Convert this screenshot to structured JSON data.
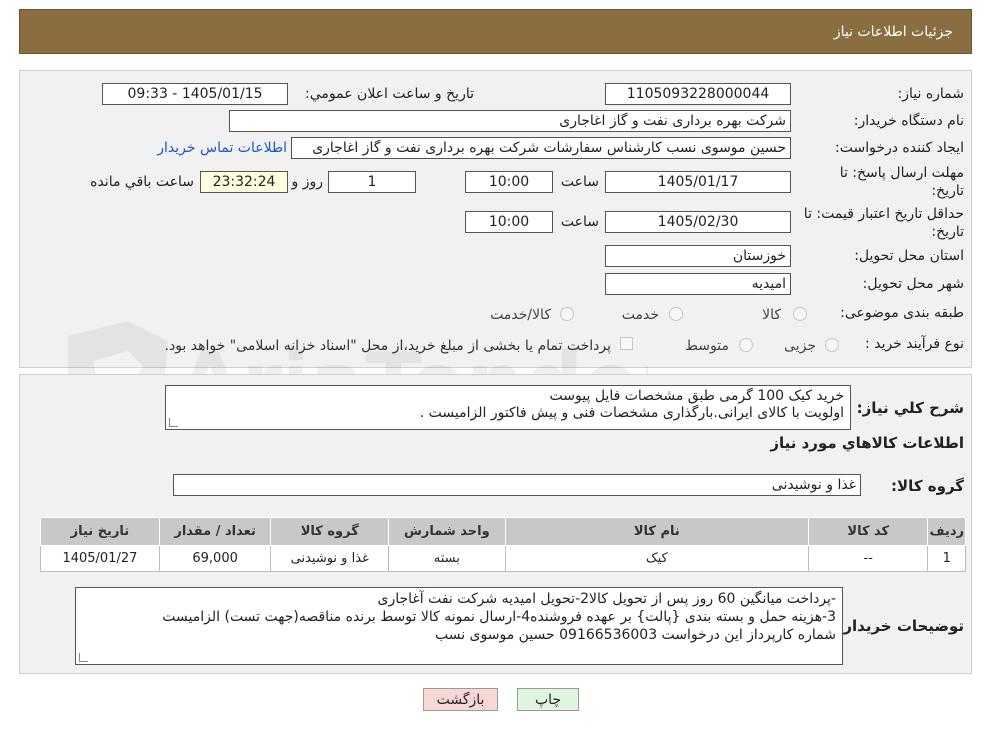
{
  "header": {
    "title": "جزئیات اطلاعات نیاز"
  },
  "form": {
    "need_number_label": "شماره نیاز:",
    "need_number": "1105093228000044",
    "announce_label": "تاریخ و ساعت اعلان عمومي:",
    "announce_value": "1405/01/15 - 09:33",
    "buyer_org_label": "نام دستگاه خریدار:",
    "buyer_org": "شرکت بهره برداری نفت و گاز اغاجاری",
    "creator_label": "ایجاد کننده درخواست:",
    "creator": "حسین موسوی نسب کارشناس سفارشات شرکت بهره برداری نفت و گاز اغاجاری",
    "contact_link": "اطلاعات تماس خریدار",
    "deadline_label_1": "مهلت ارسال پاسخ: تا",
    "deadline_label_2": "تاریخ:",
    "deadline_date": "1405/01/17",
    "time_label": "ساعت",
    "deadline_time": "10:00",
    "days_value": "1",
    "days_label": "روز و",
    "remaining_time": "23:32:24",
    "remaining_label": "ساعت باقي مانده",
    "validity_label_1": "حداقل تاریخ اعتبار قیمت: تا",
    "validity_label_2": "تاریخ:",
    "validity_date": "1405/02/30",
    "validity_time_label": "ساعت",
    "validity_time": "10:00",
    "province_label": "استان محل تحویل:",
    "province": "خوزستان",
    "city_label": "شهر محل تحویل:",
    "city": "امیدیه",
    "category_label": "طبقه بندی موضوعی:",
    "category_options": [
      "کالا",
      "خدمت",
      "کالا/خدمت"
    ],
    "process_label": "نوع فرآیند خرید :",
    "process_options": [
      "جزیی",
      "متوسط"
    ],
    "payment_note": "پرداخت تمام یا بخشی از مبلغ خرید،از محل \"اسناد خزانه اسلامی\" خواهد بود."
  },
  "description": {
    "label": "شرح کلي نياز:",
    "lines": [
      "خرید کیک 100 گرمی  طبق  مشخصات فایل پیوست",
      "اولویت با کالای ایرانی.بارگذاری مشخصات فنی و پیش فاکتور الزامیست ."
    ]
  },
  "goods": {
    "section_title": "اطلاعات کالاهاي مورد نياز",
    "group_label": "گروه کالا:",
    "group_value": "غذا و نوشیدنی",
    "table": {
      "headers": [
        "رديف",
        "کد کالا",
        "نام کالا",
        "واحد شمارش",
        "گروه کالا",
        "تعداد / مقدار",
        "تاریخ نیاز"
      ],
      "rows": [
        [
          "1",
          "--",
          "کیک",
          "بسته",
          "غذا و نوشیدنی",
          "69,000",
          "1405/01/27"
        ]
      ]
    }
  },
  "buyer_notes": {
    "label": "توضیحات خریدار:",
    "lines": [
      "-پرداخت میانگین 60 روز پس از تحویل کالا2-تحویل امیدیه شرکت نفت آغاجاری",
      "3-هزینه حمل  و بسته بندی {پالت} بر عهده فروشنده4-ارسال نمونه کالا توسط برنده مناقصه(جهت تست) الزامیست",
      "شماره کارپرداز این درخواست 09166536003 حسین موسوی نسب"
    ]
  },
  "buttons": {
    "print": "چاپ",
    "back": "بازگشت"
  },
  "watermark": {
    "text": "AriaTender.neT"
  },
  "colors": {
    "header_bg": "#8b6d42",
    "panel_bg": "#f1f1f1",
    "link": "#1a55c8",
    "back_button": "#f8d7d7",
    "print_button": "#dff5df"
  }
}
